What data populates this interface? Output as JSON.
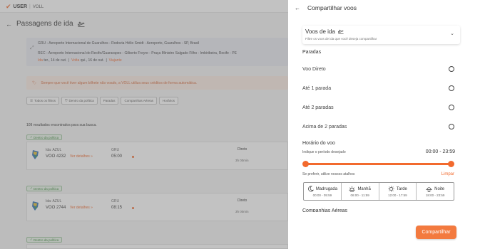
{
  "app": {
    "logo_mark": "✔",
    "logo_text": "USER",
    "logo_partner": "VOLL"
  },
  "page": {
    "back": "←",
    "title": "Passagens de ida",
    "title_icon": "plane-departure-icon"
  },
  "route": {
    "origin": "GRU - Aeroporto Internacional de Guarulhos - Rodovia Hélio Smidt - Aeroporto, Guarulhos - SP, Brasil",
    "destination": "REC - Aeroporto Internacional do Recife/Guararapes - Gilberto Freyre - Praça Ministro Salgado Filho - Imbiribeira, Recife - PE",
    "trip_label": "Ida",
    "trip_date": "ter., 14 de out.",
    "return_label": "Volta",
    "return_date": "qui., 16 de out.",
    "traveler": "Viajante"
  },
  "notice": "Sempre que você tiver algum bilhete não voado, a VOLL utiliza seus créditos de forma automática.",
  "filters": [
    "Todos os filtros",
    "Dentro da política",
    "Paradas",
    "Companhias Aéreas",
    "Horários"
  ],
  "results_text": "109 resultados encontrados para sua busca.",
  "flights": [
    {
      "tag": "Dentro da política",
      "airline": "Ida: AZUL",
      "number": "VOO 4232",
      "details": "Ver detalhes »",
      "dest": "GRU",
      "time": "05:00",
      "stop": "Direto",
      "duration": "3h 00min"
    },
    {
      "tag": "Dentro da política",
      "airline": "Ida: AZUL",
      "number": "VOO 2744",
      "details": "Ver detalhes »",
      "dest": "GRU",
      "time": "08:15",
      "stop": "Direto",
      "duration": "3h 00min"
    },
    {
      "tag": "Dentro da política"
    }
  ],
  "panel": {
    "back": "←",
    "title": "Compartilhar voos",
    "section": {
      "title": "Voos de ida",
      "subtitle": "Filtre os voos de ida que você deseja compartilhar"
    },
    "stops_title": "Paradas",
    "stops": [
      "Voo Direto",
      "Até 1 parada",
      "Até 2 paradas",
      "Acima de 2 paradas"
    ],
    "time_title": "Horário do voo",
    "time_hint": "Indique o período desejado",
    "time_range": "00:00  -  23:59",
    "range": {
      "start": 0,
      "end": 1
    },
    "shortcut_hint": "Se preferir, utilize nossos atalhos",
    "clear": "Limpar",
    "periods": [
      {
        "name": "Madrugada",
        "range": "00:00 - 05:59",
        "icon": "moon-icon"
      },
      {
        "name": "Manhã",
        "range": "06:00 - 11:59",
        "icon": "sunrise-icon"
      },
      {
        "name": "Tarde",
        "range": "12:00 - 17:59",
        "icon": "sun-icon"
      },
      {
        "name": "Noite",
        "range": "18:00 - 23:59",
        "icon": "sunset-icon"
      }
    ],
    "airlines_title": "Companhias Aéreas",
    "share_button": "Compartilhar"
  },
  "colors": {
    "accent": "#f26a2e",
    "policy_green": "#3b8a3b"
  }
}
